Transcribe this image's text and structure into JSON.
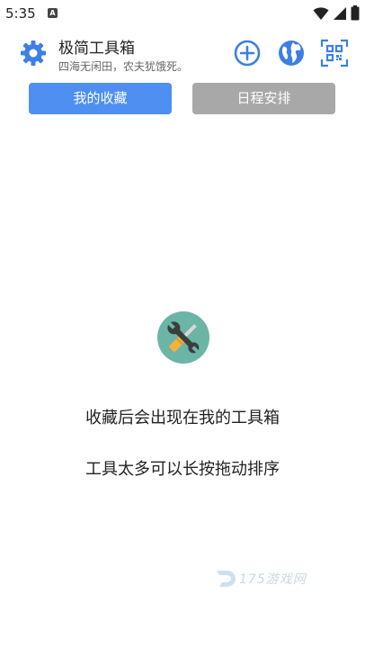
{
  "status_bar": {
    "time": "5:35",
    "notification_icon": "A"
  },
  "header": {
    "title": "极简工具箱",
    "subtitle": "四海无闲田，农夫犹饿死。"
  },
  "tabs": [
    {
      "label": "我的收藏",
      "active": true
    },
    {
      "label": "日程安排",
      "active": false
    }
  ],
  "empty_state": {
    "line1": "收藏后会出现在我的工具箱",
    "line2": "工具太多可以长按拖动排序"
  },
  "watermark": {
    "text": "175游戏网"
  },
  "colors": {
    "accent": "#4f8ff2",
    "tab_inactive": "#a8a8a8",
    "icon_circle": "#6ab5a6"
  }
}
